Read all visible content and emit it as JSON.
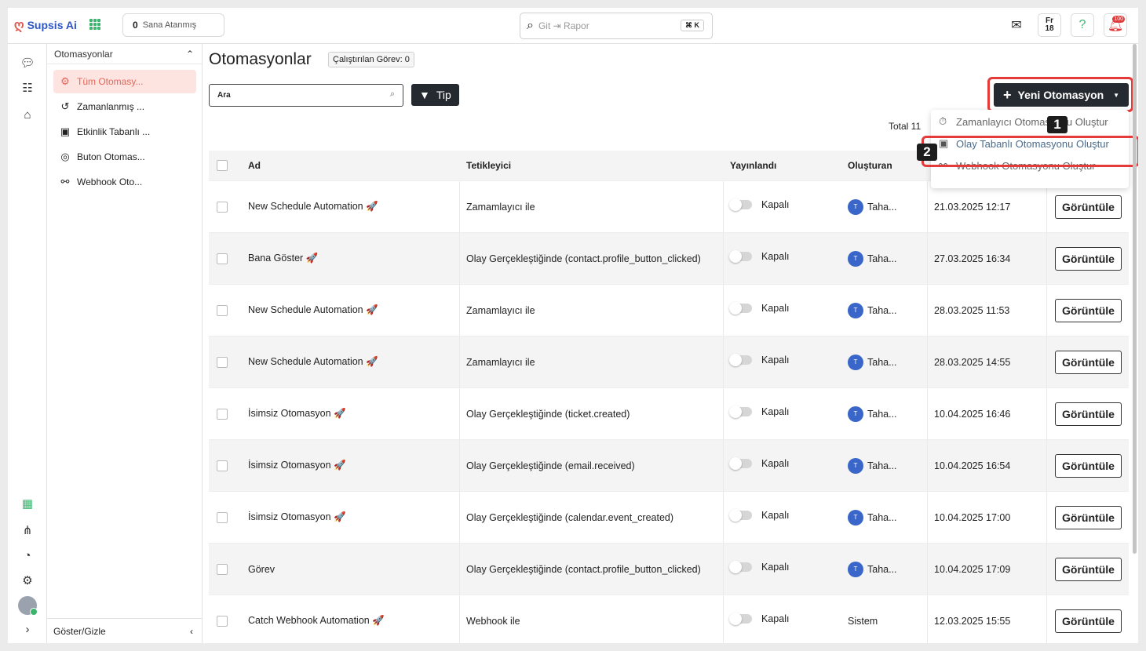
{
  "brand": {
    "logo_text": "Supsis Ai"
  },
  "header": {
    "assigned_count": "0",
    "assigned_label": "Sana Atanmış",
    "search_placeholder": "Git ⇥ Rapor",
    "shortcut": "⌘ K",
    "fr_label": "Fr",
    "fr_count": "18",
    "notif_badge": "100"
  },
  "sidebar": {
    "section_title": "Otomasyonlar",
    "items": [
      {
        "label": "Tüm Otomasy...",
        "icon": "gear-icon"
      },
      {
        "label": "Zamanlanmış ...",
        "icon": "history-icon"
      },
      {
        "label": "Etkinlik Tabanlı ...",
        "icon": "calendar-icon"
      },
      {
        "label": "Buton Otomas...",
        "icon": "click-icon"
      },
      {
        "label": "Webhook Oto...",
        "icon": "webhook-icon"
      }
    ],
    "footer_label": "Göster/Gizle"
  },
  "main": {
    "title": "Otomasyonlar",
    "running_tasks": "Çalıştırılan Görev: 0",
    "search_value": "Ara",
    "filter_label": "Tip",
    "new_button": "Yeni Otomasyon",
    "total": "Total 11"
  },
  "dropdown": {
    "items": [
      "Zamanlayıcı Otomasyonu Oluştur",
      "Olay Tabanlı Otomasyonu Oluştur",
      "Webhook Otomasyonu Oluştur"
    ],
    "step1": "1",
    "step2": "2"
  },
  "table": {
    "headers": {
      "name": "Ad",
      "trigger": "Tetikleyici",
      "published": "Yayınlandı",
      "created_by": "Oluşturan"
    },
    "rows": [
      {
        "name": "New Schedule Automation 🚀",
        "trigger": "Zamamlayıcı ile",
        "status": "Kapalı",
        "avatar": "T",
        "creator": "Taha...",
        "date": "21.03.2025 12:17",
        "action": "Görüntüle"
      },
      {
        "name": "Bana Göster 🚀",
        "trigger": "Olay Gerçekleştiğinde (contact.profile_button_clicked)",
        "status": "Kapalı",
        "avatar": "T",
        "creator": "Taha...",
        "date": "27.03.2025 16:34",
        "action": "Görüntüle"
      },
      {
        "name": "New Schedule Automation 🚀",
        "trigger": "Zamamlayıcı ile",
        "status": "Kapalı",
        "avatar": "T",
        "creator": "Taha...",
        "date": "28.03.2025 11:53",
        "action": "Görüntüle"
      },
      {
        "name": "New Schedule Automation 🚀",
        "trigger": "Zamamlayıcı ile",
        "status": "Kapalı",
        "avatar": "T",
        "creator": "Taha...",
        "date": "28.03.2025 14:55",
        "action": "Görüntüle"
      },
      {
        "name": "İsimsiz Otomasyon 🚀",
        "trigger": "Olay Gerçekleştiğinde (ticket.created)",
        "status": "Kapalı",
        "avatar": "T",
        "creator": "Taha...",
        "date": "10.04.2025 16:46",
        "action": "Görüntüle"
      },
      {
        "name": "İsimsiz Otomasyon 🚀",
        "trigger": "Olay Gerçekleştiğinde (email.received)",
        "status": "Kapalı",
        "avatar": "T",
        "creator": "Taha...",
        "date": "10.04.2025 16:54",
        "action": "Görüntüle"
      },
      {
        "name": "İsimsiz Otomasyon 🚀",
        "trigger": "Olay Gerçekleştiğinde (calendar.event_created)",
        "status": "Kapalı",
        "avatar": "T",
        "creator": "Taha...",
        "date": "10.04.2025 17:00",
        "action": "Görüntüle"
      },
      {
        "name": "Görev",
        "trigger": "Olay Gerçekleştiğinde (contact.profile_button_clicked)",
        "status": "Kapalı",
        "avatar": "T",
        "creator": "Taha...",
        "date": "10.04.2025 17:09",
        "action": "Görüntüle"
      },
      {
        "name": "Catch Webhook Automation 🚀",
        "trigger": "Webhook ile",
        "status": "Kapalı",
        "avatar": "",
        "creator": "Sistem",
        "date": "12.03.2025 15:55",
        "action": "Görüntüle"
      }
    ]
  }
}
